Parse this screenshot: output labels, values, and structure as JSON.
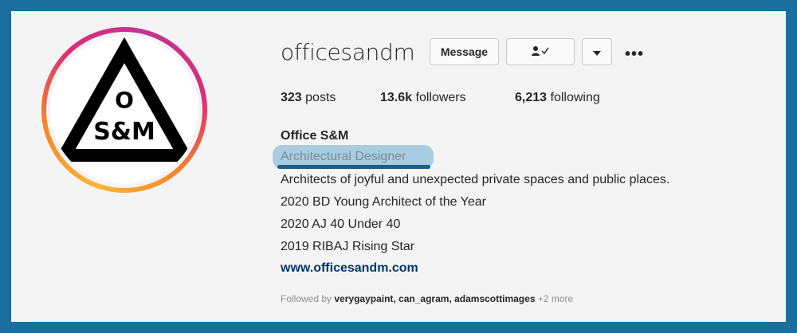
{
  "profile": {
    "username": "officesandm",
    "logo_text": {
      "top": "O",
      "bottom": "S&M"
    }
  },
  "actions": {
    "message_label": "Message",
    "following_icon": "person-check-icon",
    "dropdown_icon": "caret-down-icon",
    "more_icon": "more-horizontal-icon"
  },
  "stats": {
    "posts_count": "323",
    "posts_label": "posts",
    "followers_count": "13.6k",
    "followers_label": "followers",
    "following_count": "6,213",
    "following_label": "following"
  },
  "bio": {
    "full_name": "Office S&M",
    "category": "Architectural Designer",
    "lines": [
      "Architects of joyful and unexpected private spaces and public places.",
      "2020 BD Young Architect of the Year",
      "2020 AJ 40 Under 40",
      "2019 RIBAJ Rising Star"
    ],
    "website": "www.officesandm.com"
  },
  "followed_by": {
    "prefix": "Followed by",
    "names": "verygaypaint, can_agram, adamscottimages",
    "more": "+2 more"
  },
  "colors": {
    "frame_border": "#1b6f9e",
    "highlight": "#a9cde0",
    "underline": "#1d5d86",
    "link": "#00376b"
  }
}
